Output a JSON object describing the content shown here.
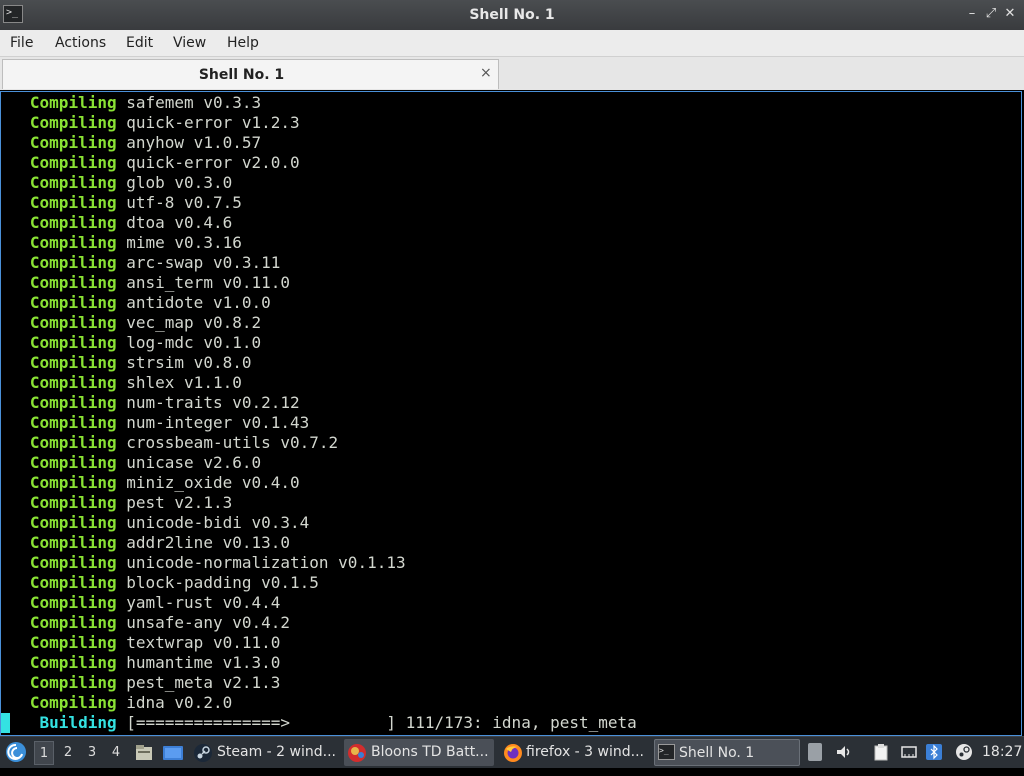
{
  "window": {
    "title": "Shell No. 1",
    "icon": "terminal-icon"
  },
  "menu": [
    "File",
    "Actions",
    "Edit",
    "View",
    "Help"
  ],
  "tab": {
    "label": "Shell No. 1",
    "close": "×"
  },
  "terminal": {
    "lines": [
      {
        "keyword": "Compiling",
        "text": "safemem v0.3.3"
      },
      {
        "keyword": "Compiling",
        "text": "quick-error v1.2.3"
      },
      {
        "keyword": "Compiling",
        "text": "anyhow v1.0.57"
      },
      {
        "keyword": "Compiling",
        "text": "quick-error v2.0.0"
      },
      {
        "keyword": "Compiling",
        "text": "glob v0.3.0"
      },
      {
        "keyword": "Compiling",
        "text": "utf-8 v0.7.5"
      },
      {
        "keyword": "Compiling",
        "text": "dtoa v0.4.6"
      },
      {
        "keyword": "Compiling",
        "text": "mime v0.3.16"
      },
      {
        "keyword": "Compiling",
        "text": "arc-swap v0.3.11"
      },
      {
        "keyword": "Compiling",
        "text": "ansi_term v0.11.0"
      },
      {
        "keyword": "Compiling",
        "text": "antidote v1.0.0"
      },
      {
        "keyword": "Compiling",
        "text": "vec_map v0.8.2"
      },
      {
        "keyword": "Compiling",
        "text": "log-mdc v0.1.0"
      },
      {
        "keyword": "Compiling",
        "text": "strsim v0.8.0"
      },
      {
        "keyword": "Compiling",
        "text": "shlex v1.1.0"
      },
      {
        "keyword": "Compiling",
        "text": "num-traits v0.2.12"
      },
      {
        "keyword": "Compiling",
        "text": "num-integer v0.1.43"
      },
      {
        "keyword": "Compiling",
        "text": "crossbeam-utils v0.7.2"
      },
      {
        "keyword": "Compiling",
        "text": "unicase v2.6.0"
      },
      {
        "keyword": "Compiling",
        "text": "miniz_oxide v0.4.0"
      },
      {
        "keyword": "Compiling",
        "text": "pest v2.1.3"
      },
      {
        "keyword": "Compiling",
        "text": "unicode-bidi v0.3.4"
      },
      {
        "keyword": "Compiling",
        "text": "addr2line v0.13.0"
      },
      {
        "keyword": "Compiling",
        "text": "unicode-normalization v0.1.13"
      },
      {
        "keyword": "Compiling",
        "text": "block-padding v0.1.5"
      },
      {
        "keyword": "Compiling",
        "text": "yaml-rust v0.4.4"
      },
      {
        "keyword": "Compiling",
        "text": "unsafe-any v0.4.2"
      },
      {
        "keyword": "Compiling",
        "text": "textwrap v0.11.0"
      },
      {
        "keyword": "Compiling",
        "text": "humantime v1.3.0"
      },
      {
        "keyword": "Compiling",
        "text": "pest_meta v2.1.3"
      },
      {
        "keyword": "Compiling",
        "text": "idna v0.2.0"
      }
    ],
    "progress": {
      "keyword": "Building",
      "bar": "[===============>          ]",
      "status": "111/173: idna, pest_meta"
    },
    "colors": {
      "keyword": "#8ae234",
      "building": "#34e2e2",
      "text": "#d3d7cf",
      "cursor": "#34e2e2"
    }
  },
  "taskbar": {
    "start_icon": "debian-swirl-icon",
    "workspaces": [
      "1",
      "2",
      "3",
      "4"
    ],
    "active_workspace": "1",
    "launchers": [
      "file-manager-icon",
      "show-desktop-icon"
    ],
    "tasks": [
      {
        "label": "Steam - 2 wind...",
        "icon": "steam-icon"
      },
      {
        "label": "Bloons TD Batt...",
        "icon": "bloons-icon"
      },
      {
        "label": "firefox - 3 wind...",
        "icon": "firefox-icon"
      },
      {
        "label": "Shell No. 1",
        "icon": "terminal-icon",
        "active": true
      }
    ],
    "tray_icons": [
      "scroll-icon",
      "volume-icon",
      "clipboard-icon",
      "network-icon",
      "bluetooth-icon",
      "steam-tray-icon"
    ],
    "clock": "18:27"
  }
}
